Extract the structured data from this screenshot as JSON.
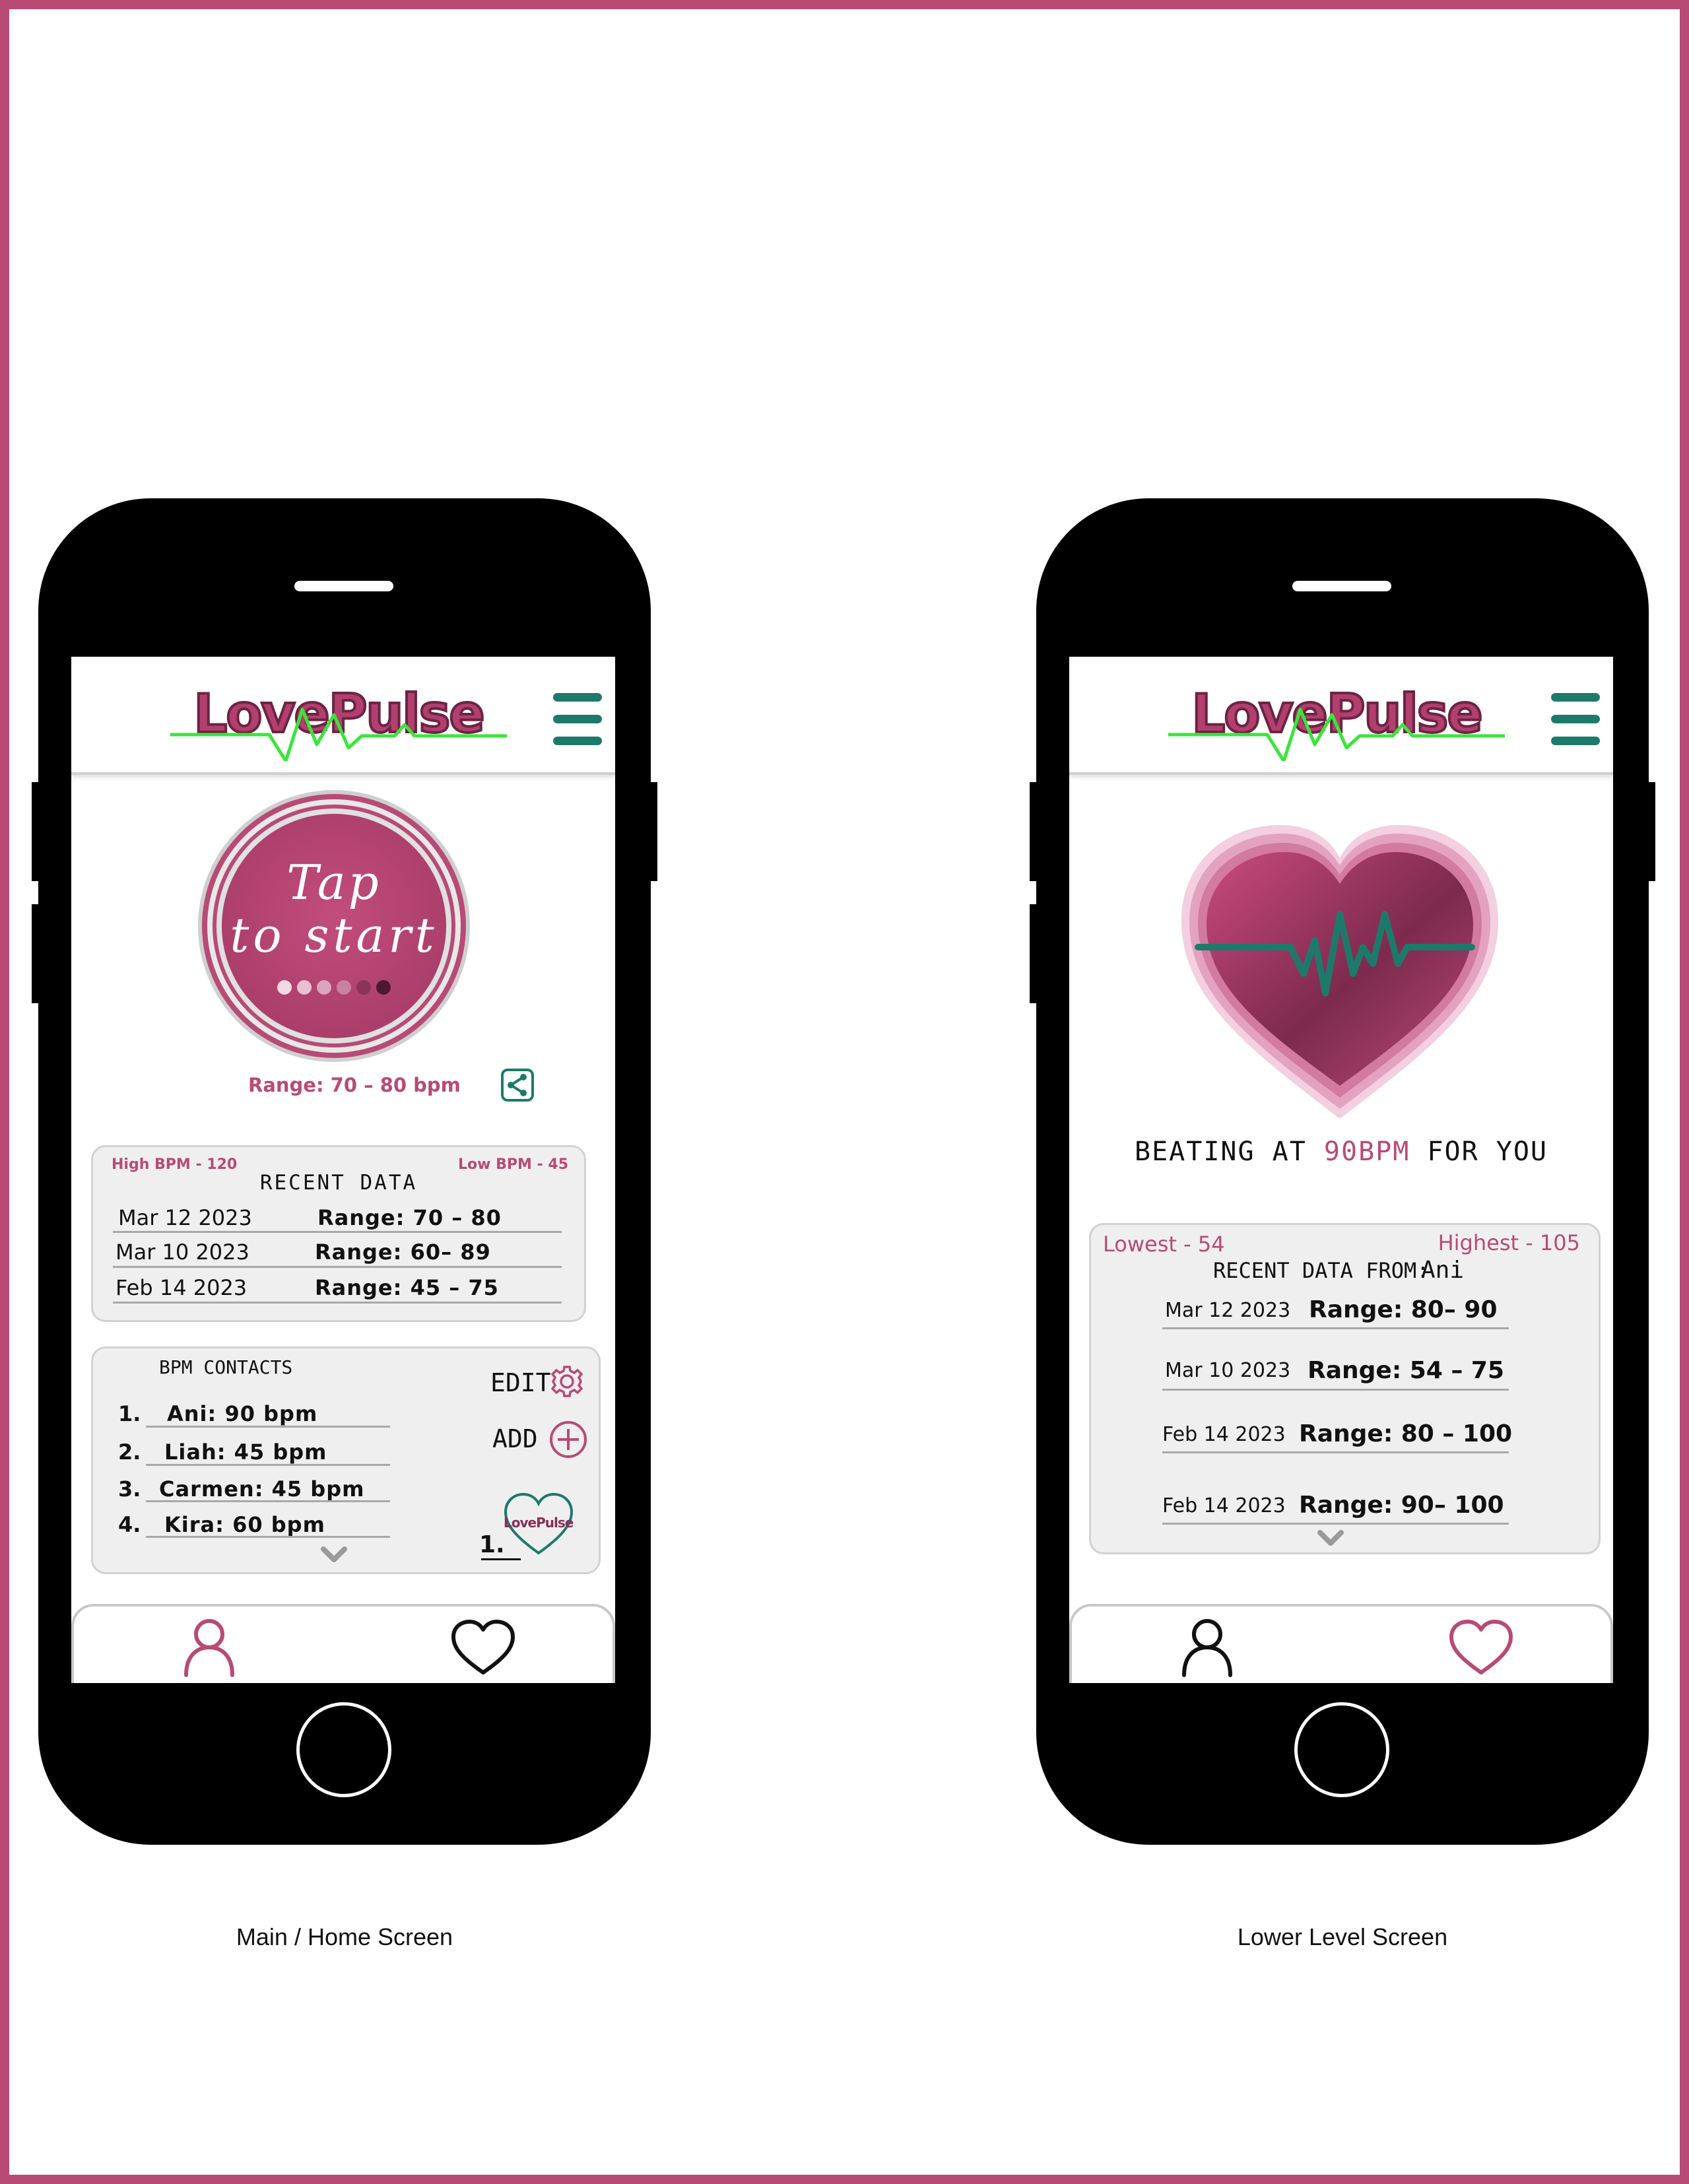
{
  "colors": {
    "accent": "#b84a76",
    "teal": "#1d7a6a",
    "pulse_green": "#39e639",
    "panel": "#efefef"
  },
  "captions": {
    "left": "Main / Home Screen",
    "right": "Lower Level Screen"
  },
  "home": {
    "logo": "LovePulse",
    "tap_button": {
      "line1": "Tap",
      "line2": "to start"
    },
    "range": "Range: 70 – 80 bpm",
    "recent": {
      "title": "RECENT DATA",
      "high": "High BPM - 120",
      "low": "Low BPM - 45",
      "rows": [
        {
          "date": "Mar 12 2023",
          "range": "Range: 70 – 80"
        },
        {
          "date": "Mar 10 2023",
          "range": "Range: 60– 89"
        },
        {
          "date": "Feb 14 2023",
          "range": "Range: 45 – 75"
        }
      ]
    },
    "contacts": {
      "title": "BPM CONTACTS",
      "edit": "EDIT",
      "add": "ADD",
      "badge_logo": "LovePulse",
      "badge_number": "1.",
      "items": [
        {
          "num": "1.",
          "text": "Ani:  90 bpm"
        },
        {
          "num": "2.",
          "text": "Liah:  45 bpm"
        },
        {
          "num": "3.",
          "text": "Carmen:  45 bpm"
        },
        {
          "num": "4.",
          "text": "Kira:  60 bpm"
        }
      ]
    }
  },
  "detail": {
    "logo": "LovePulse",
    "beating": {
      "prefix": "BEATING AT ",
      "value": "90BPM",
      "suffix": " FOR YOU"
    },
    "recent": {
      "lowest": "Lowest - 54",
      "highest": "Highest - 105",
      "title": "RECENT DATA FROM:",
      "name": "Ani",
      "rows": [
        {
          "date": "Mar 12 2023",
          "range": "Range: 80– 90"
        },
        {
          "date": "Mar 10 2023",
          "range": "Range: 54 – 75"
        },
        {
          "date": "Feb 14 2023",
          "range": "Range: 80 – 100"
        },
        {
          "date": "Feb 14 2023",
          "range": "Range: 90– 100"
        }
      ]
    }
  }
}
